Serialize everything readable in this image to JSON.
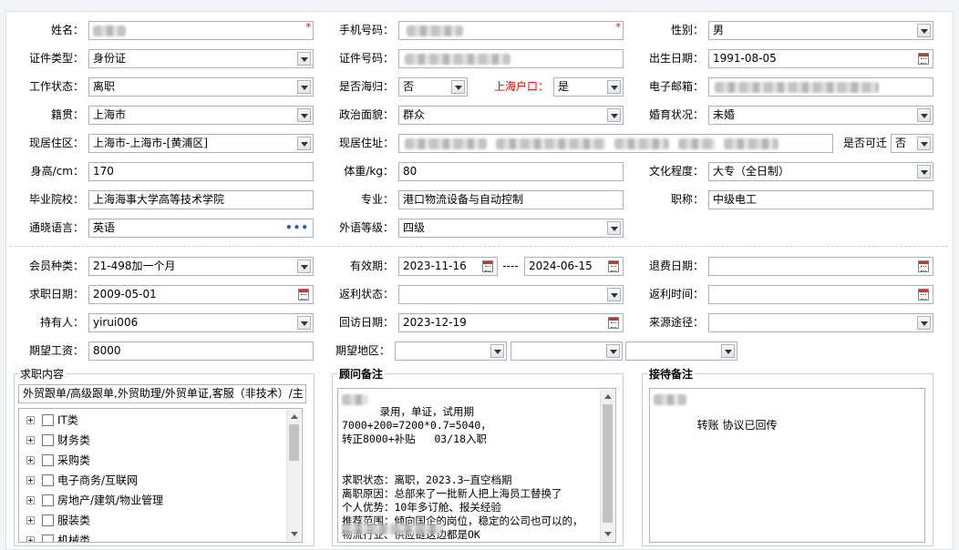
{
  "basic": {
    "name_label": "姓名：",
    "phone_label": "手机号码：",
    "required_mark": "*",
    "gender_label": "性别：",
    "gender_value": "男",
    "id_type_label": "证件类型：",
    "id_type_value": "身份证",
    "id_number_label": "证件号码：",
    "birth_label": "出生日期：",
    "birth_value": "1991-08-05",
    "work_status_label": "工作状态：",
    "work_status_value": "离职",
    "returnee_label": "是否海归：",
    "returnee_value": "否",
    "hukou_label": "上海户口：",
    "hukou_value": "是",
    "email_label": "电子邮箱：",
    "native_label": "籍贯：",
    "native_value": "上海市",
    "political_label": "政治面貌：",
    "political_value": "群众",
    "marital_label": "婚育状况：",
    "marital_value": "未婚",
    "residence_label": "现居住区：",
    "residence_value": "上海市-上海市-[黄浦区]",
    "address_label": "现居住址：",
    "transferable_label": "是否可迁",
    "transferable_value": "否",
    "height_label": "身高/cm：",
    "height_value": "170",
    "weight_label": "体重/kg：",
    "weight_value": "80",
    "education_label": "文化程度：",
    "education_value": "大专（全日制）",
    "school_label": "毕业院校：",
    "school_value": "上海海事大学高等技术学院",
    "major_label": "专业：",
    "major_value": "港口物流设备与自动控制",
    "title_label": "职称：",
    "title_value": "中级电工",
    "language_label": "通晓语言：",
    "language_value": "英语",
    "language_more": "•••",
    "lang_level_label": "外语等级：",
    "lang_level_value": "四级"
  },
  "membership": {
    "member_type_label": "会员种类：",
    "member_type_value": "21-498加一个月",
    "validity_label": "有效期：",
    "validity_start": "2023-11-16",
    "validity_sep": "----",
    "validity_end": "2024-06-15",
    "refund_date_label": "退费日期：",
    "job_date_label": "求职日期：",
    "job_date_value": "2009-05-01",
    "rebate_status_label": "返利状态：",
    "rebate_time_label": "返利时间：",
    "holder_label": "持有人：",
    "holder_value": "yirui006",
    "visit_date_label": "回访日期：",
    "visit_date_value": "2023-12-19",
    "source_label": "来源途径：",
    "salary_label": "期望工资：",
    "salary_value": "8000",
    "region_label": "期望地区："
  },
  "job_content": {
    "title": "求职内容",
    "summary": "外贸跟单/高级跟单,外贸助理/外贸单证,客服（非技术）/主",
    "tree": [
      "IT类",
      "财务类",
      "采购类",
      "电子商务/互联网",
      "房地产/建筑/物业管理",
      "服装类",
      "机械类"
    ]
  },
  "advisor_notes": {
    "title": "顾问备注",
    "text": "    录用，单证，试用期7000+200=7200*0.7=5040，\n转正8000+补贴   03/18入职\n\n\n求职状态：离职，2023.3—直空档期\n离职原因：总部来了一批新人把上海员工替换了\n个人优势：10年多订舱、报关经验\n推荐范围：倾向国企的岗位，稳定的公司也可以的，\n物流行业、供应链这边都是OK"
  },
  "reception_notes": {
    "title": "接待备注",
    "text": "转账 协议已回传"
  },
  "icons": {
    "dropdown": "chevron-down-icon",
    "calendar": "calendar-icon",
    "expand": "plus-expand-icon",
    "checkbox": "checkbox-icon"
  },
  "colors": {
    "required": "#e60000",
    "hukou_label": "#e60000",
    "field_border": "#a9b3bf",
    "more_dots": "#2f5fa8"
  }
}
